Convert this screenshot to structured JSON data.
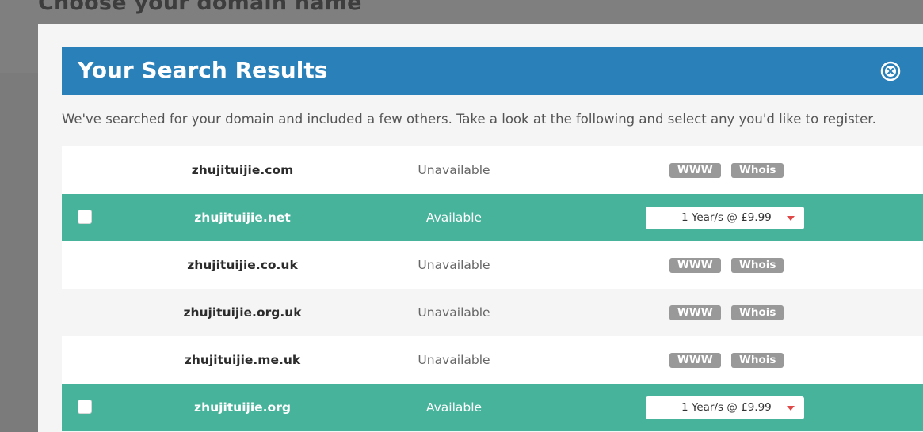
{
  "page": {
    "background_title": "Choose your domain name"
  },
  "modal": {
    "title": "Your Search Results",
    "close_icon": "close-circle-icon",
    "intro_text": "We've searched for your domain and included a few others. Take a look at the following and select any you'd like to register."
  },
  "colors": {
    "header_blue": "#2a80b9",
    "available_green": "#46b39a",
    "tag_gray": "#999999",
    "caret_red": "#e04848"
  },
  "results": [
    {
      "domain": "zhujituijie.com",
      "status": "Unavailable",
      "available": false,
      "www_label": "WWW",
      "whois_label": "Whois"
    },
    {
      "domain": "zhujituijie.net",
      "status": "Available",
      "available": true,
      "checked": false,
      "period": "1 Year/s @ £9.99"
    },
    {
      "domain": "zhujituijie.co.uk",
      "status": "Unavailable",
      "available": false,
      "www_label": "WWW",
      "whois_label": "Whois"
    },
    {
      "domain": "zhujituijie.org.uk",
      "status": "Unavailable",
      "available": false,
      "www_label": "WWW",
      "whois_label": "Whois"
    },
    {
      "domain": "zhujituijie.me.uk",
      "status": "Unavailable",
      "available": false,
      "www_label": "WWW",
      "whois_label": "Whois"
    },
    {
      "domain": "zhujituijie.org",
      "status": "Available",
      "available": true,
      "checked": false,
      "period": "1 Year/s @ £9.99"
    }
  ]
}
